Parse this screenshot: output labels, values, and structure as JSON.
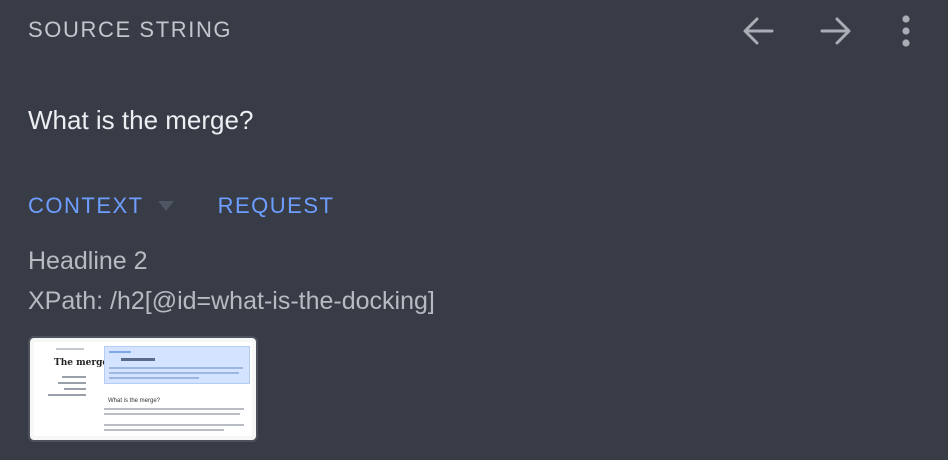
{
  "header": {
    "section_label": "SOURCE STRING",
    "icons": [
      "arrow-left-icon",
      "arrow-right-icon",
      "more-vert-icon"
    ]
  },
  "source": {
    "text": "What is the merge?"
  },
  "tabs": [
    {
      "label": "CONTEXT",
      "has_dropdown": true
    },
    {
      "label": "REQUEST"
    }
  ],
  "context": {
    "element_type": "Headline 2",
    "xpath": "XPath: /h2[@id=what-is-the-docking]"
  },
  "screenshot_thumb": {
    "title": "The merge",
    "heading": "What is the merge?"
  },
  "colors": {
    "background": "#383c47",
    "accent": "#6e9eff",
    "text_primary": "#eceef1",
    "text_secondary": "#b7bac1"
  }
}
